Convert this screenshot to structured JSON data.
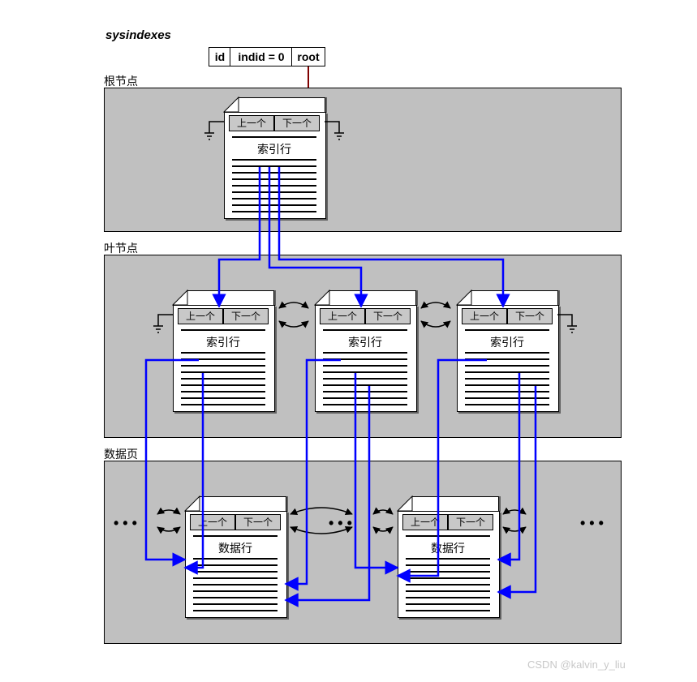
{
  "title": "sysindexes",
  "row": {
    "id": "id",
    "indid": "indid = 0",
    "root": "root"
  },
  "sections": {
    "root": "根节点",
    "leaf": "叶节点",
    "data": "数据页"
  },
  "page": {
    "prev": "上一个",
    "next": "下一个",
    "index_rows": "索引行",
    "data_rows": "数据行"
  },
  "dots": "• • •",
  "watermark": "CSDN @kalvin_y_liu",
  "colors": {
    "arrow": "#0000ff",
    "rootline": "#800000"
  }
}
